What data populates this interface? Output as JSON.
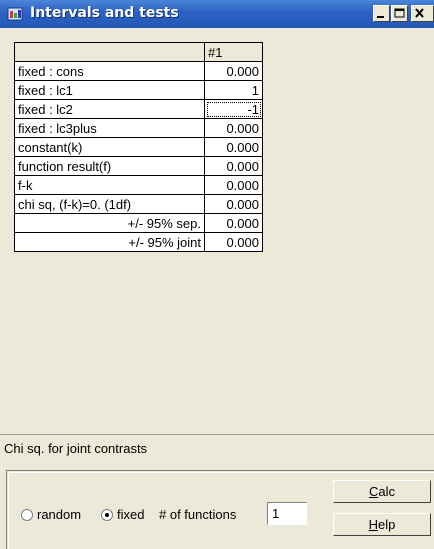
{
  "window": {
    "title": "Intervals and tests",
    "controls": [
      "minimize",
      "maximize",
      "close"
    ]
  },
  "grid": {
    "header": "#1",
    "rows": [
      {
        "label": "fixed : cons",
        "value": "0.000",
        "align": "left"
      },
      {
        "label": "fixed : lc1",
        "value": "1",
        "align": "left"
      },
      {
        "label": "fixed : lc2",
        "value": "-1",
        "align": "left",
        "focused": true
      },
      {
        "label": "fixed : lc3plus",
        "value": "0.000",
        "align": "left"
      },
      {
        "label": "constant(k)",
        "value": "0.000",
        "align": "left"
      },
      {
        "label": "function result(f)",
        "value": "0.000",
        "align": "left"
      },
      {
        "label": "f-k",
        "value": "0.000",
        "align": "left"
      },
      {
        "label": "chi sq, (f-k)=0. (1df)",
        "value": "0.000",
        "align": "left"
      },
      {
        "label": "+/- 95% sep.",
        "value": "0.000",
        "align": "right"
      },
      {
        "label": "+/- 95% joint",
        "value": "0.000",
        "align": "right"
      }
    ]
  },
  "status": {
    "text": "Chi sq. for joint contrasts"
  },
  "options": {
    "random_label": "random",
    "random_selected": false,
    "fixed_label": "fixed",
    "fixed_selected": true,
    "functions_label": "# of functions",
    "functions_value": "1"
  },
  "buttons": {
    "calc_label": "Calc",
    "calc_hotkey": "C",
    "calc_rest": "alc",
    "help_label": "Help",
    "help_hotkey": "H",
    "help_rest": "elp"
  },
  "colors": {
    "titlebar": "#2f62c4",
    "face": "#ece9d8"
  }
}
